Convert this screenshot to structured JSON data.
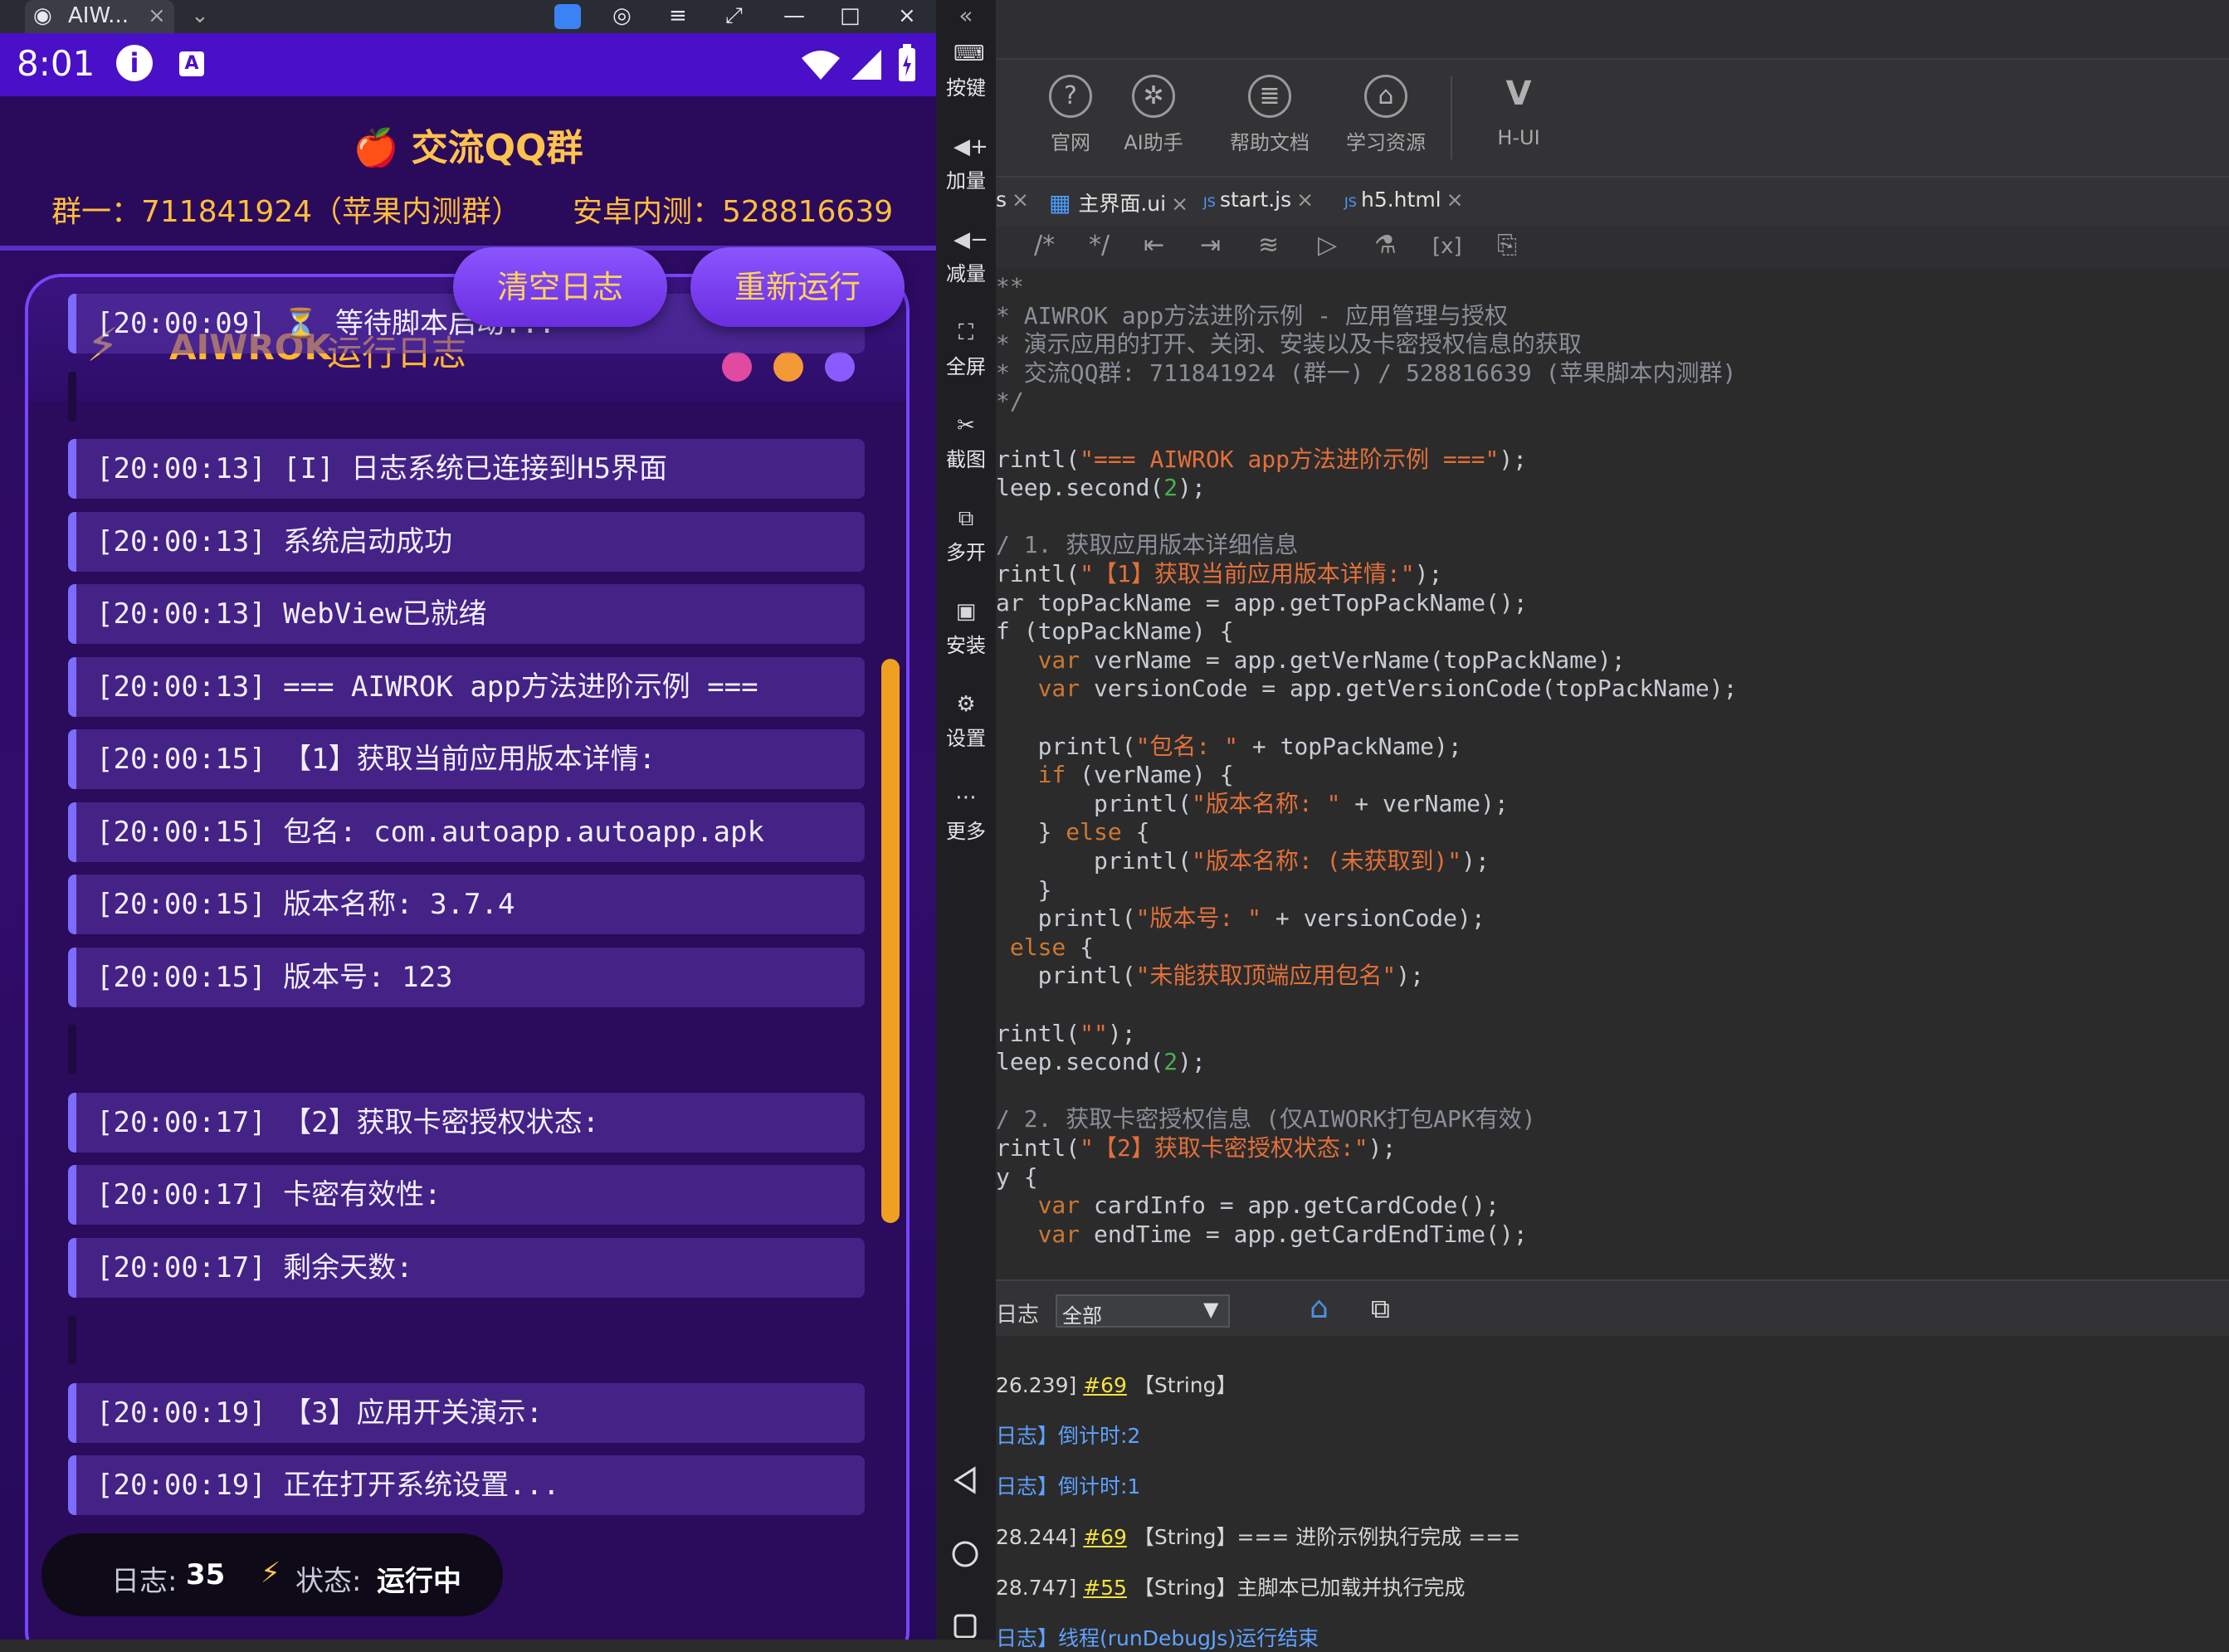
{
  "emulator": {
    "tab_title": "AIW...",
    "tab_close": "×",
    "status_time": "8:01",
    "sidebar": [
      {
        "icon": "keyboard-icon",
        "label": "按键"
      },
      {
        "icon": "volume-up-icon",
        "label": "加量"
      },
      {
        "icon": "volume-down-icon",
        "label": "减量"
      },
      {
        "icon": "fullscreen-icon",
        "label": "全屏"
      },
      {
        "icon": "scissors-icon",
        "label": "截图"
      },
      {
        "icon": "multi-instance-icon",
        "label": "多开"
      },
      {
        "icon": "apk-install-icon",
        "label": "安装"
      },
      {
        "icon": "settings-icon",
        "label": "设置"
      },
      {
        "icon": "more-icon",
        "label": "更多"
      }
    ]
  },
  "app": {
    "qq_title": "🍎 交流QQ群",
    "qq_group1": "群一：711841924（苹果内测群）",
    "qq_android": "安卓内测：528816639",
    "clear_button": "清空日志",
    "rerun_button": "重新运行",
    "log_title_prefix": "⚡",
    "log_title_brand": "AIWROK",
    "log_title_rest": " 运行日志",
    "logs": [
      "[20:00:09] ⏳ 等待脚本启动...",
      "",
      "[20:00:13] [I] 日志系统已连接到H5界面",
      "[20:00:13] 系统启动成功",
      "[20:00:13] WebView已就绪",
      "[20:00:13] === AIWROK app方法进阶示例 ===",
      "[20:00:15] 【1】获取当前应用版本详情:",
      "[20:00:15] 包名: com.autoapp.autoapp.apk",
      "[20:00:15] 版本名称: 3.7.4",
      "[20:00:15] 版本号: 123",
      "",
      "[20:00:17] 【2】获取卡密授权状态:",
      "[20:00:17] 卡密有效性:",
      "[20:00:17] 剩余天数:",
      "",
      "[20:00:19] 【3】应用开关演示:",
      "[20:00:19] 正在打开系统设置..."
    ],
    "stats": {
      "log_label": "日志:",
      "log_count": "35",
      "status_icon": "⚡",
      "status_label": "状态:",
      "status_value": "运行中"
    }
  },
  "ide": {
    "collapse_icon": "«",
    "tools": [
      {
        "icon": "help-circle-icon",
        "label": "官网"
      },
      {
        "icon": "openai-icon",
        "label": "AI助手"
      },
      {
        "icon": "document-icon",
        "label": "帮助文档"
      },
      {
        "icon": "graduation-cap-icon",
        "label": "学习资源"
      },
      {
        "icon": "vue-logo-icon",
        "label": "H-UI"
      }
    ],
    "tabs": [
      {
        "label": "s",
        "close": "×"
      },
      {
        "label": "主界面.ui",
        "close": "×"
      },
      {
        "label": "start.js",
        "close": "×"
      },
      {
        "label": "h5.html",
        "close": "×"
      }
    ],
    "code": [
      "**",
      "* AIWROK app方法进阶示例 - 应用管理与授权",
      "* 演示应用的打开、关闭、安装以及卡密授权信息的获取",
      "* 交流QQ群: 711841924 (群一) / 528816639 (苹果脚本内测群)",
      "*/",
      "",
      "rintl(\"=== AIWROK app方法进阶示例 ===\");",
      "leep.second(2);",
      "",
      "/ 1. 获取应用版本详细信息",
      "rintl(\"【1】获取当前应用版本详情:\");",
      "ar topPackName = app.getTopPackName();",
      "f (topPackName) {",
      "   var verName = app.getVerName(topPackName);",
      "   var versionCode = app.getVersionCode(topPackName);",
      "",
      "   printl(\"包名: \" + topPackName);",
      "   if (verName) {",
      "       printl(\"版本名称: \" + verName);",
      "   } else {",
      "       printl(\"版本名称: (未获取到)\");",
      "   }",
      "   printl(\"版本号: \" + versionCode);",
      " else {",
      "   printl(\"未能获取顶端应用包名\");",
      "",
      "rintl(\"\");",
      "leep.second(2);",
      "",
      "/ 2. 获取卡密授权信息 (仅AIWORK打包APK有效)",
      "rintl(\"【2】获取卡密授权状态:\");",
      "y {",
      "   var cardInfo = app.getCardCode();",
      "   var endTime = app.getCardEndTime();"
    ],
    "log_panel": {
      "label": "日志",
      "filter_value": "全部",
      "lines": [
        {
          "prefix": "26.239] ",
          "link": "#69",
          "text": " 【String】"
        },
        {
          "prefix": "",
          "link": "",
          "text": "日志】倒计时:2"
        },
        {
          "prefix": "",
          "link": "",
          "text": "日志】倒计时:1"
        },
        {
          "prefix": "28.244] ",
          "link": "#69",
          "text": " 【String】=== 进阶示例执行完成 ==="
        },
        {
          "prefix": "28.747] ",
          "link": "#55",
          "text": " 【String】主脚本已加载并执行完成"
        },
        {
          "prefix": "",
          "link": "",
          "text": "日志】线程(runDebugJs)运行结束"
        }
      ]
    }
  },
  "colors": {
    "phone_bg": "#2a0a5c",
    "accent_purple": "#7846ff",
    "gold": "#ffc34d",
    "scroll": "#f0a020"
  }
}
